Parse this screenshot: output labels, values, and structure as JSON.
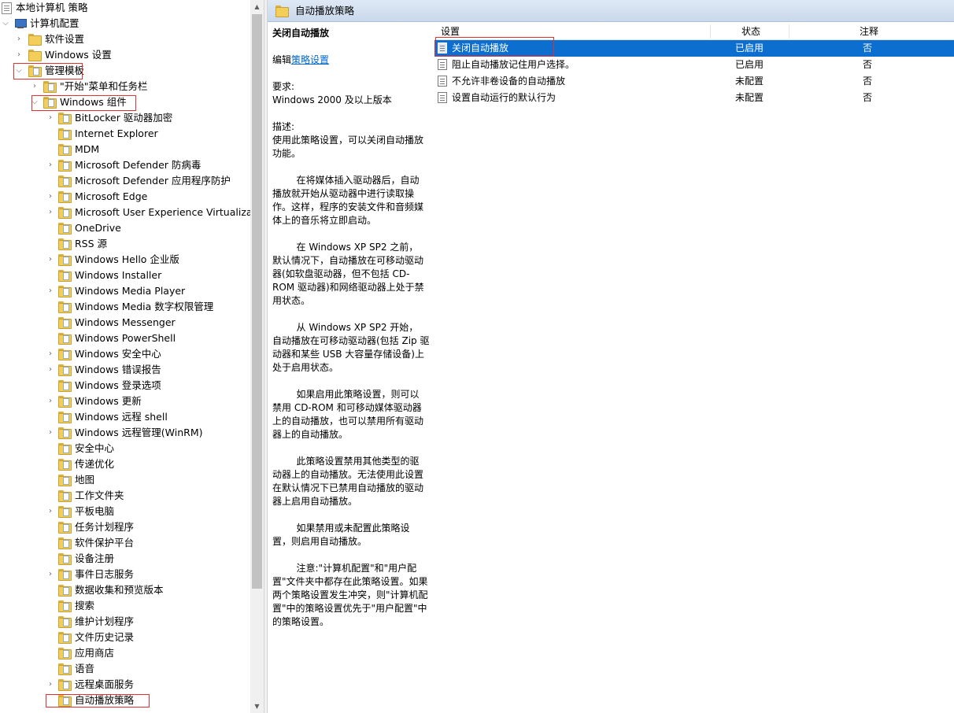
{
  "tree": {
    "root": "本地计算机 策略",
    "computer_config": "计算机配置",
    "software_settings": "软件设置",
    "windows_settings": "Windows 设置",
    "admin_templates": "管理模板",
    "start_menu": "\"开始\"菜单和任务栏",
    "windows_components": "Windows 组件",
    "items": [
      "BitLocker 驱动器加密",
      "Internet Explorer",
      "MDM",
      "Microsoft Defender 防病毒",
      "Microsoft Defender 应用程序防护",
      "Microsoft Edge",
      "Microsoft User Experience Virtualization",
      "OneDrive",
      "RSS 源",
      "Windows Hello 企业版",
      "Windows Installer",
      "Windows Media Player",
      "Windows Media 数字权限管理",
      "Windows Messenger",
      "Windows PowerShell",
      "Windows 安全中心",
      "Windows 错误报告",
      "Windows 登录选项",
      "Windows 更新",
      "Windows 远程 shell",
      "Windows 远程管理(WinRM)",
      "安全中心",
      "传递优化",
      "地图",
      "工作文件夹",
      "平板电脑",
      "任务计划程序",
      "软件保护平台",
      "设备注册",
      "事件日志服务",
      "数据收集和预览版本",
      "搜索",
      "维护计划程序",
      "文件历史记录",
      "应用商店",
      "语音",
      "远程桌面服务",
      "自动播放策略"
    ],
    "expandable": [
      true,
      false,
      false,
      true,
      false,
      true,
      true,
      false,
      false,
      true,
      false,
      true,
      false,
      false,
      false,
      true,
      true,
      false,
      true,
      false,
      true,
      false,
      false,
      false,
      false,
      true,
      false,
      false,
      false,
      true,
      false,
      false,
      false,
      false,
      false,
      false,
      true,
      false
    ]
  },
  "right_pane": {
    "header_title": "自动播放策略",
    "description": {
      "title": "关闭自动播放",
      "edit_prefix": "编辑",
      "edit_link": "策略设置",
      "requirements_label": "要求:",
      "requirements_value": "Windows 2000 及以上版本",
      "description_label": "描述:",
      "lines": [
        "使用此策略设置，可以关闭自动播放",
        "功能。",
        "",
        "        在将媒体插入驱动器后，自动",
        "播放就开始从驱动器中进行读取操",
        "作。这样，程序的安装文件和音频媒",
        "体上的音乐将立即启动。",
        "",
        "        在 Windows XP SP2 之前，",
        "默认情况下，自动播放在可移动驱动",
        "器(如软盘驱动器，但不包括 CD-",
        "ROM 驱动器)和网络驱动器上处于禁",
        "用状态。",
        "",
        "        从 Windows XP SP2 开始，",
        "自动播放在可移动驱动器(包括 Zip 驱",
        "动器和某些 USB 大容量存储设备)上",
        "处于启用状态。",
        "",
        "        如果启用此策略设置，则可以",
        "禁用 CD-ROM 和可移动媒体驱动器",
        "上的自动播放，也可以禁用所有驱动",
        "器上的自动播放。",
        "",
        "        此策略设置禁用其他类型的驱",
        "动器上的自动播放。无法使用此设置",
        "在默认情况下已禁用自动播放的驱动",
        "器上启用自动播放。",
        "",
        "        如果禁用或未配置此策略设",
        "置，则启用自动播放。",
        "",
        "        注意:\"计算机配置\"和\"用户配",
        "置\"文件夹中都存在此策略设置。如果",
        "两个策略设置发生冲突，则\"计算机配",
        "置\"中的策略设置优先于\"用户配置\"中",
        "的策略设置。"
      ]
    },
    "list": {
      "columns": {
        "setting": "设置",
        "state": "状态",
        "comment": "注释"
      },
      "rows": [
        {
          "setting": "关闭自动播放",
          "state": "已启用",
          "comment": "否",
          "selected": true
        },
        {
          "setting": "阻止自动播放记住用户选择。",
          "state": "已启用",
          "comment": "否",
          "selected": false
        },
        {
          "setting": "不允许非卷设备的自动播放",
          "state": "未配置",
          "comment": "否",
          "selected": false
        },
        {
          "setting": "设置自动运行的默认行为",
          "state": "未配置",
          "comment": "否",
          "selected": false
        }
      ]
    }
  },
  "colors": {
    "selection": "#0c6fd0",
    "highlight_box": "#e03030",
    "link": "#0066cc"
  }
}
